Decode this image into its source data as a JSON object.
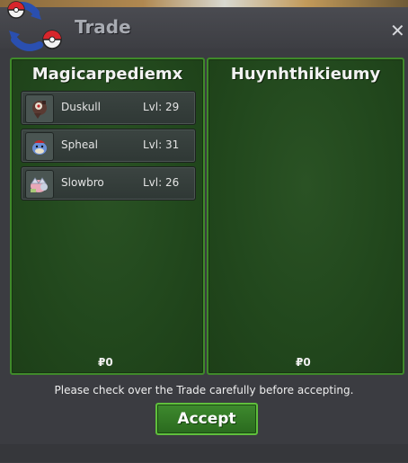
{
  "window": {
    "title": "Trade",
    "close_symbol": "✕"
  },
  "left": {
    "player": "Magicarpediemx",
    "pokemon": [
      {
        "name": "Duskull",
        "level": "Lvl: 29",
        "icon": "duskull-sprite-icon"
      },
      {
        "name": "Spheal",
        "level": "Lvl: 31",
        "icon": "spheal-sprite-icon"
      },
      {
        "name": "Slowbro",
        "level": "Lvl: 26",
        "icon": "slowbro-sprite-icon"
      }
    ],
    "money": "₽0"
  },
  "right": {
    "player": "Huynhthikieumy",
    "pokemon": [],
    "money": "₽0"
  },
  "notice": "Please check over the Trade carefully before accepting.",
  "accept_label": "Accept",
  "colors": {
    "panel_green": "#22481d",
    "panel_border": "#3f8a2a",
    "accept_green": "#3e8a2e",
    "window_bg": "#3b3c41"
  }
}
